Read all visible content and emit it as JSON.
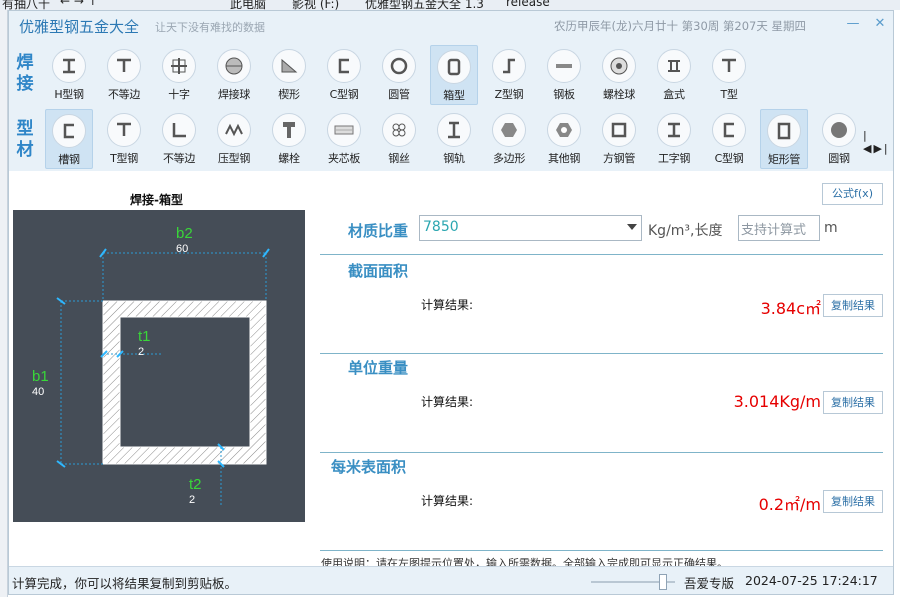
{
  "background": {
    "crumbs": [
      "此电脑",
      "影视 (F:)",
      "优雅型钢五金大全 1.3",
      "release"
    ],
    "left_fragment": "有抽八十"
  },
  "window": {
    "title": "优雅型钢五金大全",
    "subtitle": "让天下没有难找的数据",
    "lunar_date": "农历甲辰年(龙)六月廿十 第30周 第207天 星期四",
    "buttons": [
      "minimize",
      "close"
    ]
  },
  "toolbar": {
    "welding_label": [
      "焊",
      "接"
    ],
    "profile_label": [
      "型",
      "材"
    ],
    "welding_items": [
      {
        "label": "H型钢",
        "icon": "h-beam-icon"
      },
      {
        "label": "不等边",
        "icon": "t-shape-icon"
      },
      {
        "label": "十字",
        "icon": "cross-icon"
      },
      {
        "label": "焊接球",
        "icon": "sphere-icon"
      },
      {
        "label": "楔形",
        "icon": "wedge-icon"
      },
      {
        "label": "C型钢",
        "icon": "c-channel-icon"
      },
      {
        "label": "圆管",
        "icon": "round-tube-icon"
      },
      {
        "label": "箱型",
        "icon": "box-section-icon",
        "selected": true
      },
      {
        "label": "Z型钢",
        "icon": "z-section-icon"
      },
      {
        "label": "钢板",
        "icon": "steel-plate-icon"
      },
      {
        "label": "螺栓球",
        "icon": "bolt-ball-icon"
      },
      {
        "label": "盒式",
        "icon": "box-type-icon"
      },
      {
        "label": "T型",
        "icon": "t-section-icon"
      }
    ],
    "profile_items": [
      {
        "label": "槽钢",
        "icon": "channel-icon",
        "selected": true
      },
      {
        "label": "T型钢",
        "icon": "t-section-icon"
      },
      {
        "label": "不等边",
        "icon": "angle-icon"
      },
      {
        "label": "压型钢",
        "icon": "corrugated-icon"
      },
      {
        "label": "螺栓",
        "icon": "bolt-icon"
      },
      {
        "label": "夹芯板",
        "icon": "sandwich-panel-icon"
      },
      {
        "label": "钢丝",
        "icon": "wire-icon"
      },
      {
        "label": "钢轨",
        "icon": "rail-icon"
      },
      {
        "label": "多边形",
        "icon": "hexagon-icon"
      },
      {
        "label": "其他钢",
        "icon": "hex-nut-icon"
      },
      {
        "label": "方钢管",
        "icon": "square-tube-icon"
      },
      {
        "label": "工字钢",
        "icon": "i-beam-icon"
      },
      {
        "label": "C型钢",
        "icon": "c-channel-icon"
      },
      {
        "label": "矩形管",
        "icon": "rect-tube-icon",
        "selected": true
      },
      {
        "label": "圆钢",
        "icon": "round-bar-icon"
      }
    ]
  },
  "diagram": {
    "title": "焊接-箱型",
    "b2": {
      "label": "b2",
      "value": "60"
    },
    "t1": {
      "label": "t1",
      "value": "2"
    },
    "b1": {
      "label": "b1",
      "value": "40"
    },
    "t2": {
      "label": "t2",
      "value": "2"
    }
  },
  "formula_button": "公式f(x)",
  "inputs": {
    "density_label": "材质比重",
    "density_value": "7850",
    "density_unit": "Kg/m³,长度",
    "length_placeholder": "支持计算式",
    "length_unit": "m"
  },
  "results": [
    {
      "title": "截面面积",
      "label": "计算结果:",
      "value": "3.84c㎡",
      "copy": "复制结果"
    },
    {
      "title": "单位重量",
      "label": "计算结果:",
      "value": "3.014Kg/m",
      "copy": "复制结果"
    },
    {
      "title": "每米表面积",
      "label": "计算结果:",
      "value": "0.2㎡/m",
      "copy": "复制结果"
    }
  ],
  "usage": "使用说明：请在左图提示位置处，输入所需数据。全部输入完成即可显示正确结果。",
  "status": {
    "message": "计算完成，你可以将结果复制到剪贴板。",
    "edition": "吾爱专版",
    "datetime": "2024-07-25 17:24:17",
    "slider_level": 0.9
  },
  "colors": {
    "accent": "#2f86c8",
    "result": "#e60000",
    "diagram_bg": "#454d57",
    "dimension_label": "#39d639"
  }
}
